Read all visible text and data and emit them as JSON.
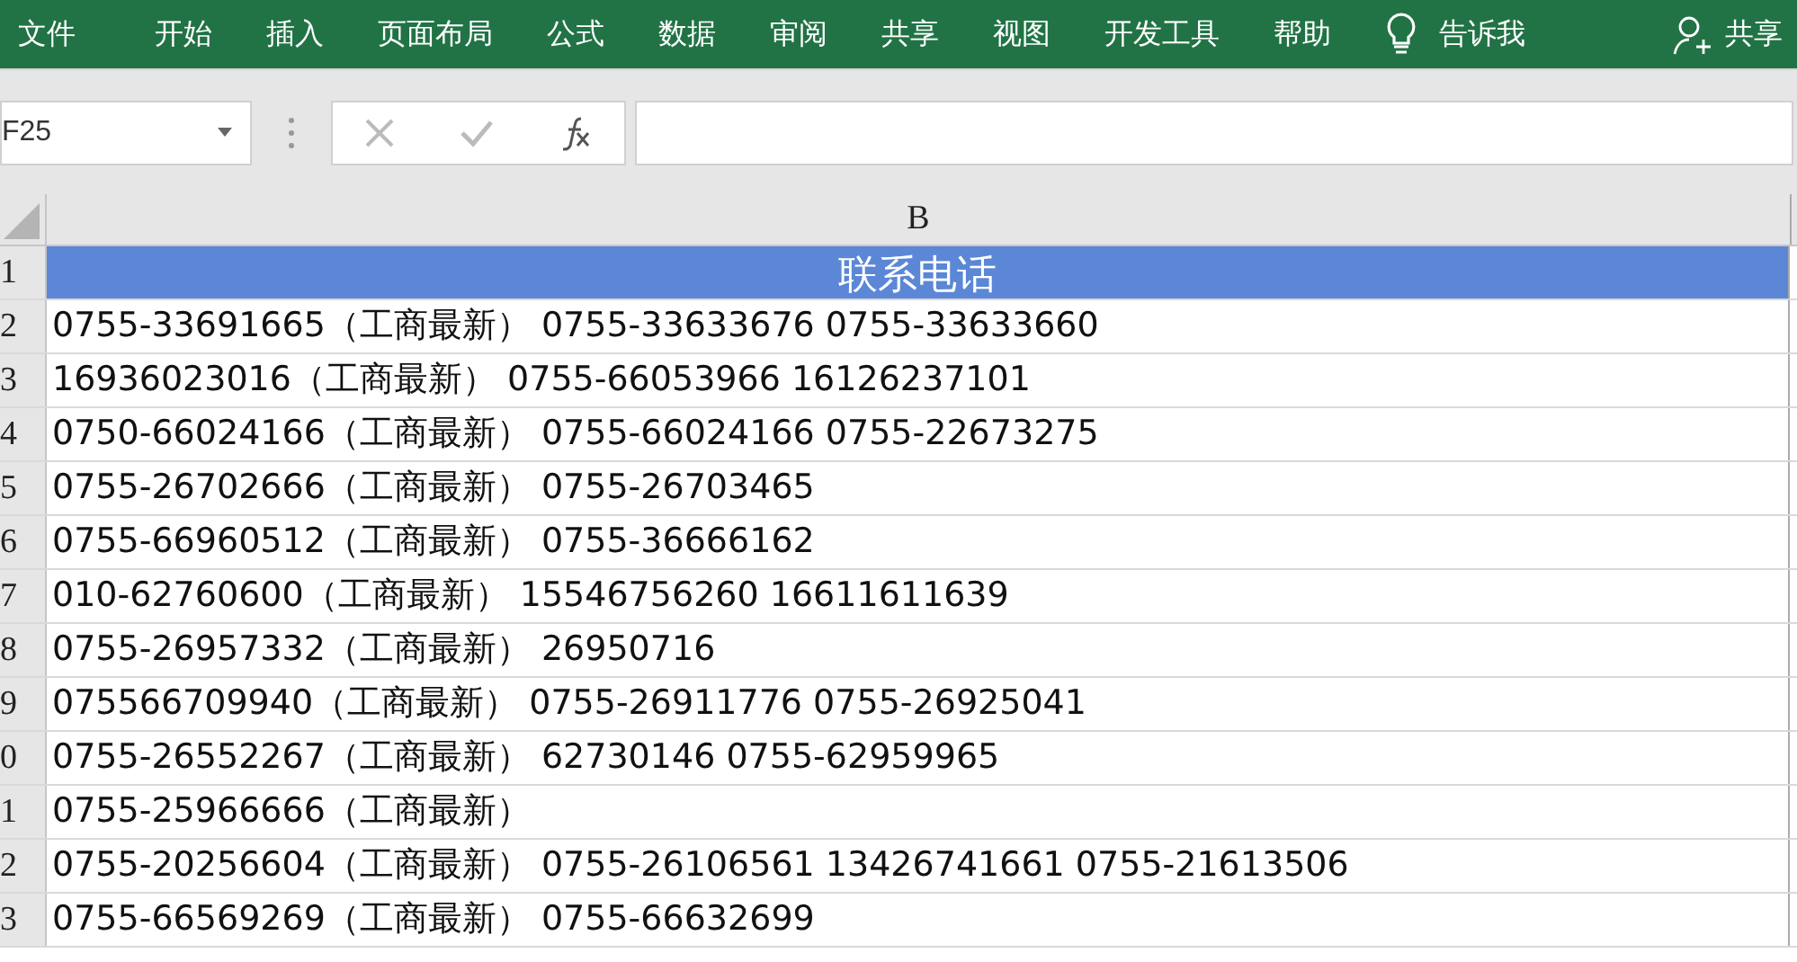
{
  "ribbon": {
    "tabs": [
      {
        "label": "文件"
      },
      {
        "label": "开始"
      },
      {
        "label": "插入"
      },
      {
        "label": "页面布局"
      },
      {
        "label": "公式"
      },
      {
        "label": "数据"
      },
      {
        "label": "审阅"
      },
      {
        "label": "共享"
      },
      {
        "label": "视图"
      },
      {
        "label": "开发工具"
      },
      {
        "label": "帮助"
      }
    ],
    "tell_me": "告诉我",
    "share": "共享"
  },
  "formula_bar": {
    "name_box": "F25"
  },
  "sheet": {
    "column_header": "B",
    "rows": [
      {
        "header": "1",
        "kind": "title",
        "value": "联系电话"
      },
      {
        "header": "2",
        "kind": "data",
        "value": "0755-33691665（工商最新） 0755-33633676 0755-33633660"
      },
      {
        "header": "3",
        "kind": "data",
        "value": "16936023016（工商最新） 0755-66053966 16126237101"
      },
      {
        "header": "4",
        "kind": "data",
        "value": "0750-66024166（工商最新） 0755-66024166 0755-22673275"
      },
      {
        "header": "5",
        "kind": "data",
        "value": "0755-26702666（工商最新） 0755-26703465"
      },
      {
        "header": "6",
        "kind": "data",
        "value": "0755-66960512（工商最新） 0755-36666162"
      },
      {
        "header": "7",
        "kind": "data",
        "value": "010-62760600（工商最新） 15546756260 16611611639"
      },
      {
        "header": "8",
        "kind": "data",
        "value": "0755-26957332（工商最新） 26950716"
      },
      {
        "header": "9",
        "kind": "data",
        "value": "075566709940（工商最新） 0755-26911776 0755-26925041"
      },
      {
        "header": "0",
        "kind": "data",
        "value": "0755-26552267（工商最新） 62730146 0755-62959965"
      },
      {
        "header": "1",
        "kind": "data",
        "value": "0755-25966666（工商最新）"
      },
      {
        "header": "2",
        "kind": "data",
        "value": "0755-20256604（工商最新） 0755-26106561 13426741661 0755-21613506"
      },
      {
        "header": "3",
        "kind": "data",
        "value": "0755-66569269（工商最新） 0755-66632699"
      }
    ]
  }
}
